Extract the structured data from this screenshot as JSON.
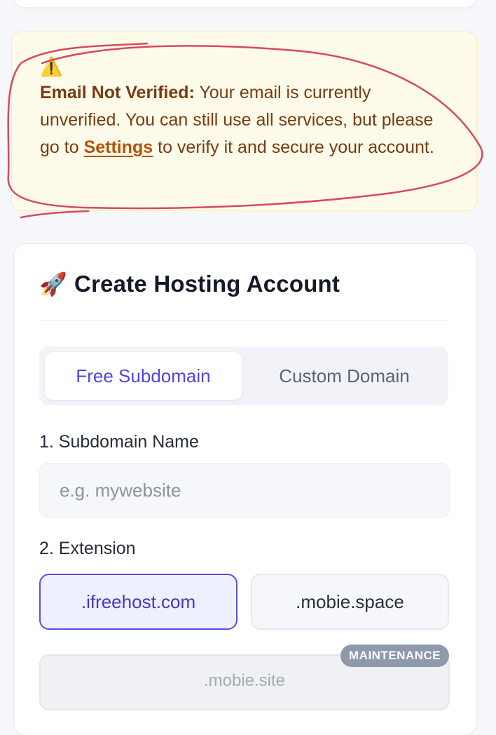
{
  "alert": {
    "icon": "warning-icon",
    "title": "Email Not Verified:",
    "text_before_link": " Your email is currently unverified. You can still use all services, but please go to ",
    "link": "Settings",
    "text_after_link": " to verify it and secure your account.",
    "annotation_color": "#d94a5a"
  },
  "card": {
    "title_icon": "rocket-icon",
    "title": "Create Hosting Account",
    "tabs": [
      {
        "label": "Free Subdomain",
        "active": true
      },
      {
        "label": "Custom Domain",
        "active": false
      }
    ],
    "subdomain": {
      "label": "1. Subdomain Name",
      "placeholder": "e.g. mywebsite",
      "value": ""
    },
    "extension": {
      "label": "2. Extension",
      "options": [
        {
          "label": ".ifreehost.com",
          "selected": true
        },
        {
          "label": ".mobie.space",
          "selected": false
        },
        {
          "label": ".mobie.site",
          "selected": false,
          "badge": "MAINTENANCE"
        }
      ]
    }
  },
  "colors": {
    "accent": "#4f46e5",
    "alert_bg": "#fffbea",
    "alert_text": "#7a3b10",
    "badge_bg": "#8f99ab"
  }
}
